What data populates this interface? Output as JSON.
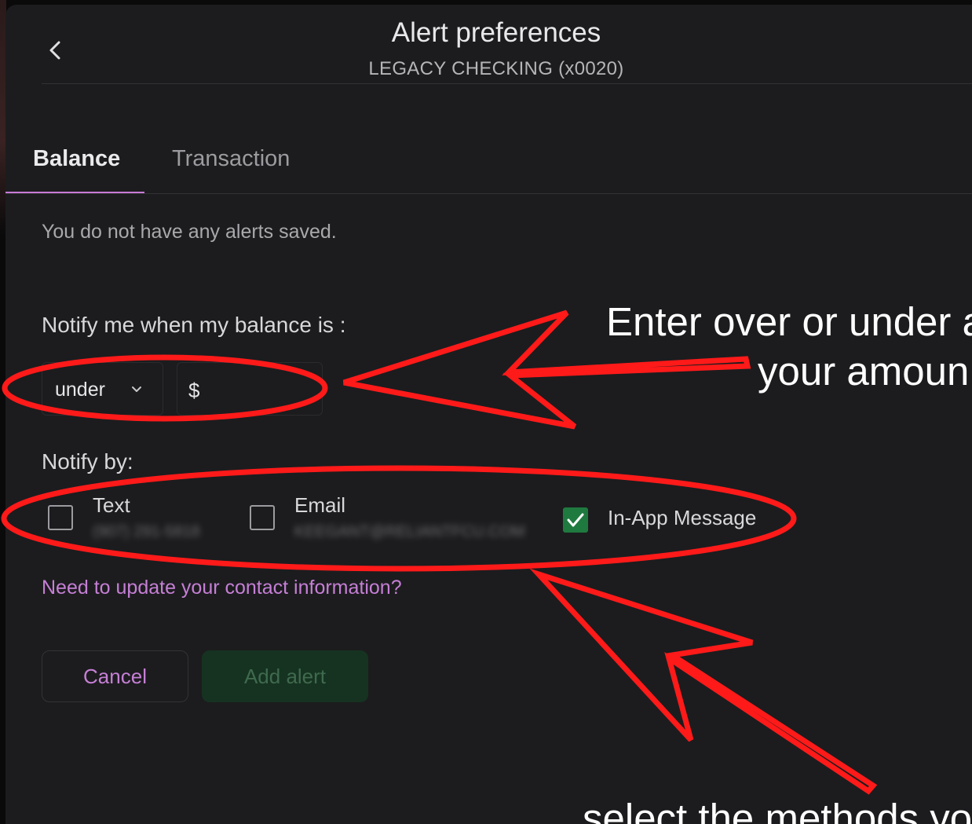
{
  "header": {
    "title": "Alert preferences",
    "subtitle": "LEGACY CHECKING (x0020)",
    "back_icon": "chevron-left-icon"
  },
  "tabs": [
    {
      "label": "Balance",
      "active": true
    },
    {
      "label": "Transaction",
      "active": false
    }
  ],
  "empty_message": "You do not have any alerts saved.",
  "balance_form": {
    "label": "Notify me when my balance is :",
    "condition": {
      "value": "under",
      "icon": "chevron-down-icon"
    },
    "amount": {
      "currency_symbol": "$",
      "value": ""
    }
  },
  "notify_by": {
    "label": "Notify by:",
    "methods": [
      {
        "label": "Text",
        "detail": "(907) 291-5818",
        "checked": false
      },
      {
        "label": "Email",
        "detail": "KEEGANT@RELIANTFCU.COM",
        "checked": false
      },
      {
        "label": "In-App Message",
        "checked": true
      }
    ]
  },
  "contact_link": "Need to update your contact information?",
  "buttons": {
    "cancel": "Cancel",
    "add_alert": "Add alert"
  },
  "annotations": {
    "amount_hint_line1": "Enter over or under a",
    "amount_hint_line2": "your amoun",
    "methods_hint": "select the methods yo"
  },
  "colors": {
    "accent": "#c67fd6",
    "checked": "#1f7a3f",
    "annotation": "#ff1a1a",
    "background": "#1c1c1e"
  }
}
